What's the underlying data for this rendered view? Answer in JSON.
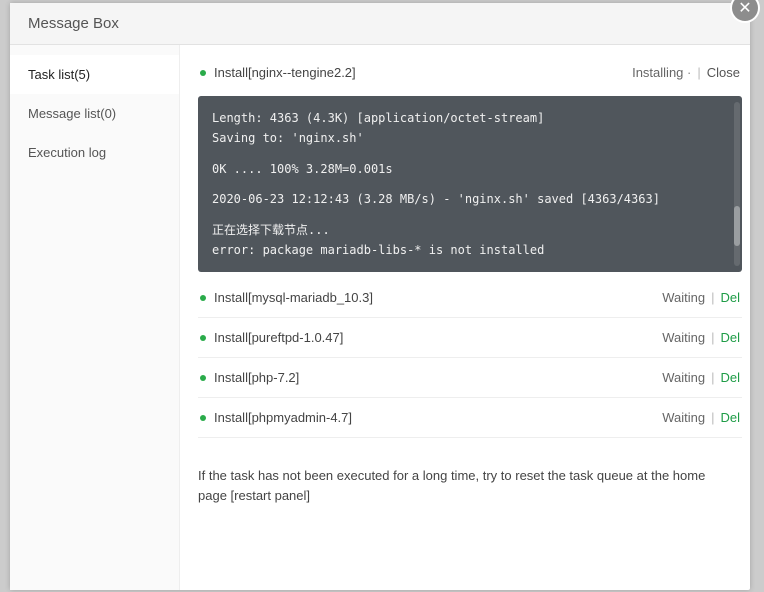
{
  "modal": {
    "title": "Message Box",
    "footer_note": "If the task has not been executed for a long time, try to reset the task queue at the home page [restart panel]"
  },
  "sidebar": {
    "items": [
      {
        "label": "Task list(5)",
        "active": true
      },
      {
        "label": "Message list(0)",
        "active": false
      },
      {
        "label": "Execution log",
        "active": false
      }
    ]
  },
  "tasks": [
    {
      "name": "Install[nginx--tengine2.2]",
      "status": "Installing",
      "running": true,
      "action": {
        "label": "Close",
        "kind": "dark"
      }
    },
    {
      "name": "Install[mysql-mariadb_10.3]",
      "status": "Waiting",
      "running": false,
      "action": {
        "label": "Del",
        "kind": "green"
      }
    },
    {
      "name": "Install[pureftpd-1.0.47]",
      "status": "Waiting",
      "running": false,
      "action": {
        "label": "Del",
        "kind": "green"
      }
    },
    {
      "name": "Install[php-7.2]",
      "status": "Waiting",
      "running": false,
      "action": {
        "label": "Del",
        "kind": "green"
      }
    },
    {
      "name": "Install[phpmyadmin-4.7]",
      "status": "Waiting",
      "running": false,
      "action": {
        "label": "Del",
        "kind": "green"
      }
    }
  ],
  "console": {
    "lines": [
      "Length: 4363 (4.3K) [application/octet-stream]",
      "Saving to: 'nginx.sh'",
      "",
      "0K .... 100% 3.28M=0.001s",
      "",
      "2020-06-23 12:12:43 (3.28 MB/s) - 'nginx.sh' saved [4363/4363]",
      "",
      "正在选择下载节点...",
      "error: package mariadb-libs-* is not installed"
    ]
  },
  "icons": {
    "close": "✕"
  }
}
